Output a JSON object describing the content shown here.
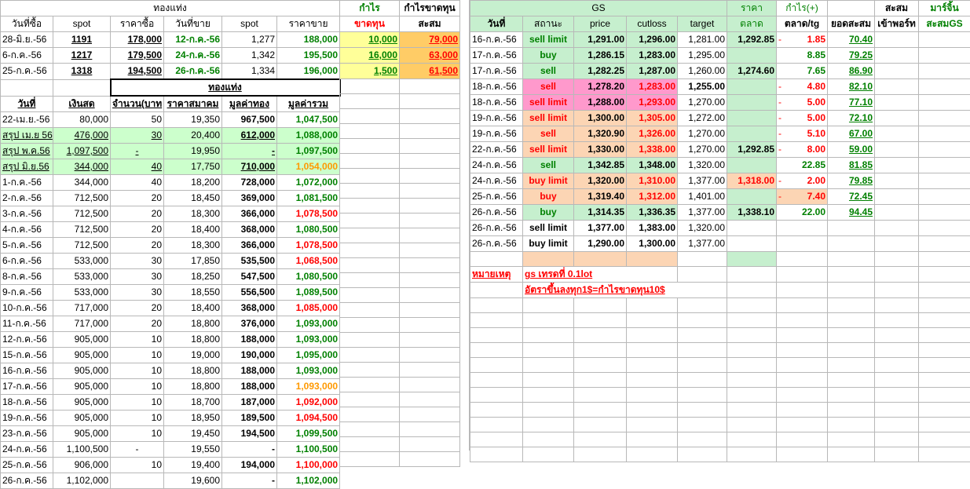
{
  "left": {
    "header1": {
      "gold_bar": "ทองแท่ง",
      "profit": "กำไร",
      "cumulative_profit_loss": "กำไรขาดทุน"
    },
    "header2": [
      "วันที่ซื้อ",
      "spot",
      "ราคาซื้อ",
      "วันที่ขาย",
      "spot",
      "ราคาขาย",
      "ขาดทุน",
      "สะสม"
    ],
    "trades": [
      [
        "28-มิ.ย.-56",
        "1191",
        "178,000",
        "12-ก.ค.-56",
        "1,277",
        "188,000",
        "10,000",
        "79,000"
      ],
      [
        "6-ก.ค.-56",
        "1217",
        "179,500",
        "24-ก.ค.-56",
        "1,342",
        "195,500",
        "16,000",
        "63,000"
      ],
      [
        "25-ก.ค.-56",
        "1318",
        "194,500",
        "26-ก.ค.-56",
        "1,334",
        "196,000",
        "1,500",
        "61,500"
      ]
    ],
    "section_title": "ทองแท่ง",
    "cols": [
      "วันที่",
      "เงินสด",
      "จำนวน(บาท",
      "ราคาสมาคม",
      "มูลค่าทอง",
      "มูลค่ารวม"
    ],
    "rows": [
      [
        "22-เม.ย.-56",
        "80,000",
        "50",
        "19,350",
        "967,500",
        "1,047,500"
      ],
      [
        "สรุป เม.ย 56",
        "476,000",
        "30",
        "20,400",
        "612,000",
        "1,088,000"
      ],
      [
        "สรุป พ.ค.56",
        "1,097,500",
        "-",
        "19,950",
        "-",
        "1,097,500"
      ],
      [
        "สรุป มิ.ย.56",
        "344,000",
        "40",
        "17,750",
        "710,000",
        "1,054,000"
      ],
      [
        "1-ก.ค.-56",
        "344,000",
        "40",
        "18,200",
        "728,000",
        "1,072,000"
      ],
      [
        "2-ก.ค.-56",
        "712,500",
        "20",
        "18,450",
        "369,000",
        "1,081,500"
      ],
      [
        "3-ก.ค.-56",
        "712,500",
        "20",
        "18,300",
        "366,000",
        "1,078,500"
      ],
      [
        "4-ก.ค.-56",
        "712,500",
        "20",
        "18,400",
        "368,000",
        "1,080,500"
      ],
      [
        "5-ก.ค.-56",
        "712,500",
        "20",
        "18,300",
        "366,000",
        "1,078,500"
      ],
      [
        "6-ก.ค.-56",
        "533,000",
        "30",
        "17,850",
        "535,500",
        "1,068,500"
      ],
      [
        "8-ก.ค.-56",
        "533,000",
        "30",
        "18,250",
        "547,500",
        "1,080,500"
      ],
      [
        "9-ก.ค.-56",
        "533,000",
        "30",
        "18,550",
        "556,500",
        "1,089,500"
      ],
      [
        "10-ก.ค.-56",
        "717,000",
        "20",
        "18,400",
        "368,000",
        "1,085,000"
      ],
      [
        "11-ก.ค.-56",
        "717,000",
        "20",
        "18,800",
        "376,000",
        "1,093,000"
      ],
      [
        "12-ก.ค.-56",
        "905,000",
        "10",
        "18,800",
        "188,000",
        "1,093,000"
      ],
      [
        "15-ก.ค.-56",
        "905,000",
        "10",
        "19,000",
        "190,000",
        "1,095,000"
      ],
      [
        "16-ก.ค.-56",
        "905,000",
        "10",
        "18,800",
        "188,000",
        "1,093,000"
      ],
      [
        "17-ก.ค.-56",
        "905,000",
        "10",
        "18,800",
        "188,000",
        "1,093,000"
      ],
      [
        "18-ก.ค.-56",
        "905,000",
        "10",
        "18,700",
        "187,000",
        "1,092,000"
      ],
      [
        "19-ก.ค.-56",
        "905,000",
        "10",
        "18,950",
        "189,500",
        "1,094,500"
      ],
      [
        "23-ก.ค.-56",
        "905,000",
        "10",
        "19,450",
        "194,500",
        "1,099,500"
      ],
      [
        "24-ก.ค.-56",
        "1,100,500",
        "-",
        "19,550",
        "-",
        "1,100,500"
      ],
      [
        "25-ก.ค.-56",
        "906,000",
        "10",
        "19,400",
        "194,000",
        "1,100,000"
      ],
      [
        "26-ก.ค.-56",
        "1,102,000",
        "",
        "19,600",
        "-",
        "1,102,000"
      ]
    ],
    "total_colors": [
      "green",
      "green",
      "green",
      "orange",
      "green",
      "green",
      "red",
      "green",
      "red",
      "red",
      "green",
      "green",
      "red",
      "green",
      "green",
      "green",
      "green",
      "orange",
      "red",
      "red",
      "green",
      "green",
      "red",
      "green"
    ]
  },
  "right": {
    "header1": {
      "gs": "GS",
      "price": "ราคา",
      "profit": "กำไร(+)",
      "cum": "สะสม",
      "margin": "มาร์จิ้น"
    },
    "header2": [
      "วันที่",
      "สถานะ",
      "price",
      "cutloss",
      "target",
      "ตลาด",
      "ตลาด/tg",
      "ยอดสะสม",
      "เข้าพอร์ท",
      "สะสมGS"
    ],
    "rows": [
      [
        "16-ก.ค.-56",
        "sell limit",
        "1,291.00",
        "1,296.00",
        "1,281.00",
        "1,292.85",
        "-",
        "1.85",
        "70.40"
      ],
      [
        "17-ก.ค.-56",
        "buy",
        "1,286.15",
        "1,283.00",
        "1,295.00",
        "",
        "",
        "8.85",
        "79.25"
      ],
      [
        "17-ก.ค.-56",
        "sell",
        "1,282.25",
        "1,287.00",
        "1,260.00",
        "1,274.60",
        "",
        "7.65",
        "86.90"
      ],
      [
        "18-ก.ค.-56",
        "sell",
        "1,278.20",
        "1,283.00",
        "1,255.00",
        "",
        "-",
        "4.80",
        "82.10"
      ],
      [
        "18-ก.ค.-56",
        "sell limit",
        "1,288.00",
        "1,293.00",
        "1,270.00",
        "",
        "-",
        "5.00",
        "77.10"
      ],
      [
        "19-ก.ค.-56",
        "sell limit",
        "1,300.00",
        "1,305.00",
        "1,272.00",
        "",
        "-",
        "5.00",
        "72.10"
      ],
      [
        "19-ก.ค.-56",
        "sell",
        "1,320.90",
        "1,326.00",
        "1,270.00",
        "",
        "-",
        "5.10",
        "67.00"
      ],
      [
        "22-ก.ค.-56",
        "sell limit",
        "1,330.00",
        "1,338.00",
        "1,270.00",
        "1,292.85",
        "-",
        "8.00",
        "59.00"
      ],
      [
        "24-ก.ค.-56",
        "sell",
        "1,342.85",
        "1,348.00",
        "1,320.00",
        "",
        "",
        "22.85",
        "81.85"
      ],
      [
        "24-ก.ค.-56",
        "buy limit",
        "1,320.00",
        "1,310.00",
        "1,377.00",
        "1,318.00",
        "-",
        "2.00",
        "79.85"
      ],
      [
        "25-ก.ค.-56",
        "buy",
        "1,319.40",
        "1,312.00",
        "1,401.00",
        "",
        "-",
        "7.40",
        "72.45"
      ],
      [
        "26-ก.ค.-56",
        "buy",
        "1,314.35",
        "1,336.35",
        "1,377.00",
        "1,338.10",
        "",
        "22.00",
        "94.45"
      ],
      [
        "26-ก.ค.-56",
        "sell limit",
        "1,377.00",
        "1,383.00",
        "1,320.00",
        "",
        "",
        "",
        ""
      ],
      [
        "26-ก.ค.-56",
        "buy limit",
        "1,290.00",
        "1,300.00",
        "1,377.00",
        "",
        "",
        "",
        ""
      ]
    ],
    "note_label": "หมายเหตุ",
    "note1": "gs เทรดที่ 0.1lot",
    "note2": "อัตราขึ้นลงทุก1$=กำไรขาดทุน10$"
  }
}
